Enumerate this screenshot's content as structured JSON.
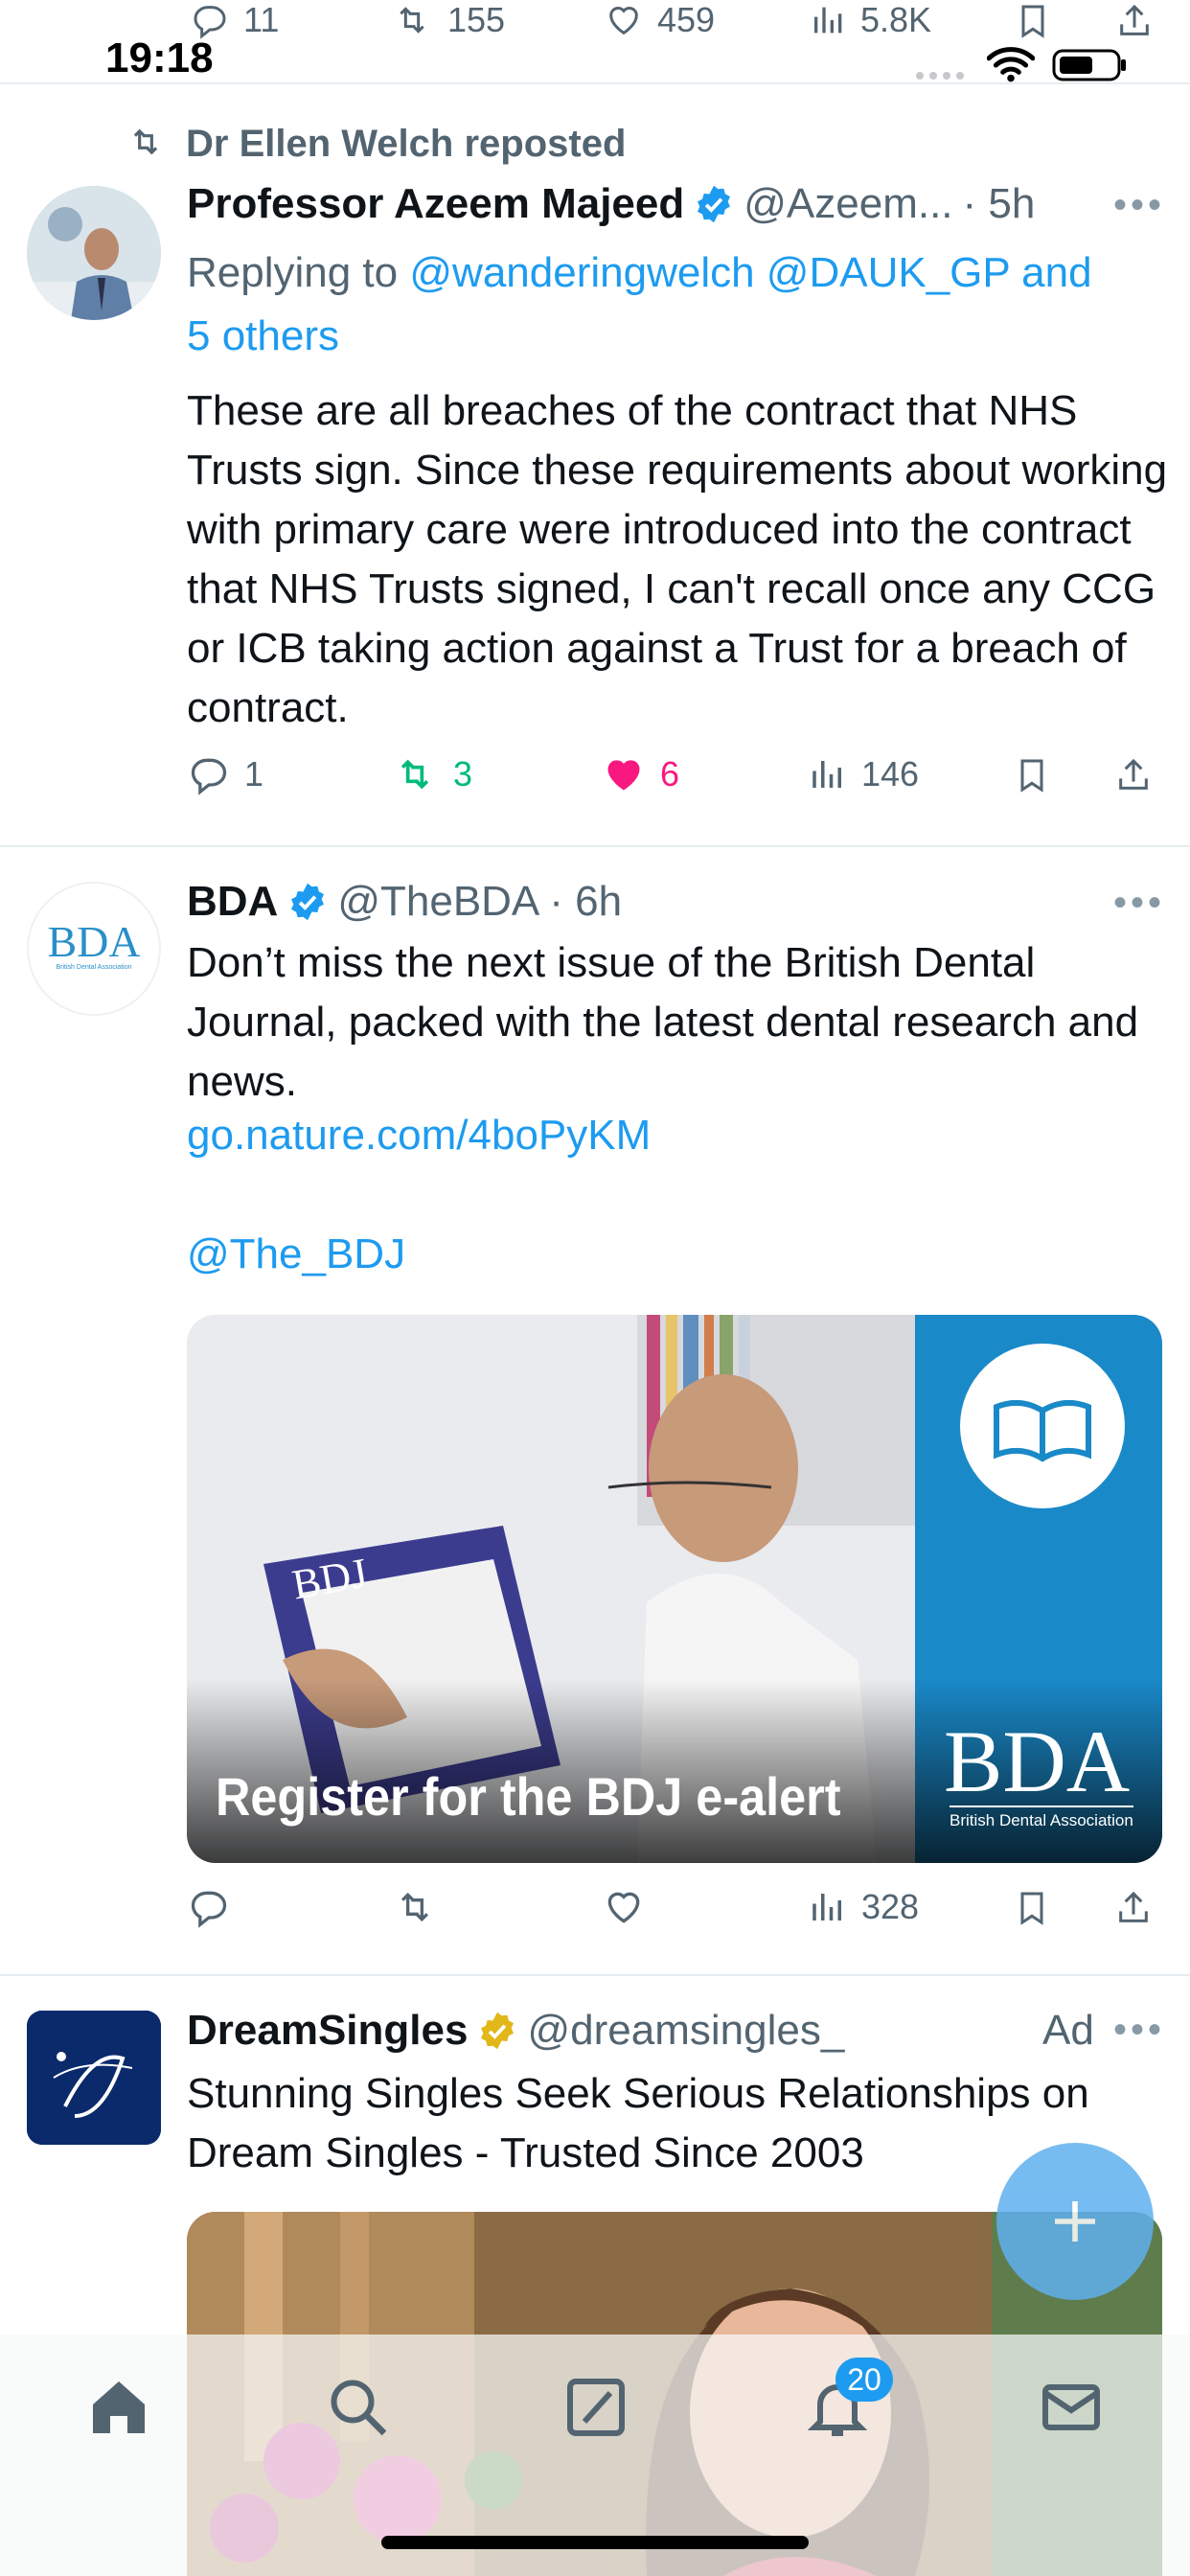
{
  "status_bar": {
    "time": "19:18"
  },
  "prev_tweet_actions": {
    "replies": "11",
    "reposts": "155",
    "likes": "459",
    "views": "5.8K"
  },
  "tweet1": {
    "repost_label": "Dr Ellen Welch reposted",
    "author_name": "Professor Azeem Majeed",
    "handle": "@Azeem...",
    "time": "· 5h",
    "replying_prefix": "Replying to",
    "replying_to": "@wanderingwelch @DAUK_GP and",
    "replying_more": "5 others",
    "text": "These are all breaches of the contract that NHS Trusts sign. Since these requirements about working with primary care were introduced into the contract that NHS Trusts signed, I can't recall once any CCG or ICB taking action against a Trust for a breach of contract.",
    "replies": "1",
    "reposts": "3",
    "likes": "6",
    "views": "146"
  },
  "tweet2": {
    "author_name": "BDA",
    "handle": "@TheBDA",
    "time": "· 6h",
    "avatar_text": "BDA",
    "avatar_subtext": "British Dental Association",
    "text": "Don’t miss the next issue of the British Dental Journal, packed with the latest dental research and news.",
    "link": "go.nature.com/4boPyKM",
    "mention": "@The_BDJ",
    "image": {
      "caption": "Register for the BDJ e-alert",
      "magazine_title": "BDJ",
      "logo_text": "BDA",
      "logo_subtext": "British Dental Association"
    },
    "views": "328"
  },
  "tweet3": {
    "author_name": "DreamSingles",
    "handle": "@dreamsingles_",
    "ad_label": "Ad",
    "text": "Stunning Singles Seek Serious Relationships on Dream Singles - Trusted Since 2003"
  },
  "nav": {
    "notifications_badge": "20"
  },
  "colors": {
    "accent": "#1d9bf0",
    "like": "#f91880",
    "repost": "#00ba7c",
    "gold": "#e2b719"
  }
}
